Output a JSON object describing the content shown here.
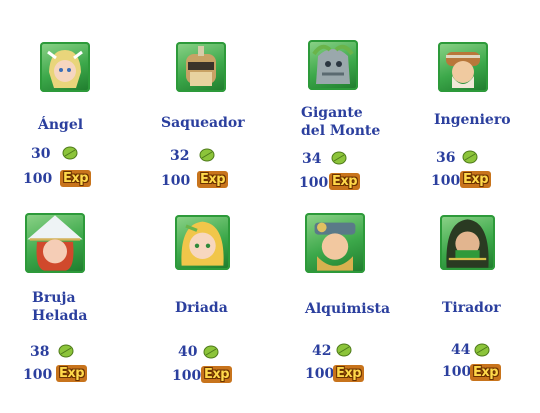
{
  "heroes": [
    {
      "name": "Ángel",
      "level": "30",
      "exp": "100",
      "exp_badge": "Exp",
      "icon": "angel-portrait",
      "hair": "#e9d57b",
      "skin": "#f6d6c0"
    },
    {
      "name": "Saqueador",
      "level": "32",
      "exp": "100",
      "exp_badge": "Exp",
      "icon": "looter-portrait",
      "hair": "#6b5a3a",
      "skin": "#c8a265"
    },
    {
      "name": "Gigante del Monte",
      "name_lines": [
        "Gigante",
        "del Monte"
      ],
      "level": "34",
      "exp": "100",
      "exp_badge": "Exp",
      "icon": "mountain-giant-portrait",
      "hair": "#7f8a8e",
      "skin": "#9aa8ac"
    },
    {
      "name": "Ingeniero",
      "level": "36",
      "exp": "100",
      "exp_badge": "Exp",
      "icon": "engineer-portrait",
      "hair": "#b8773a",
      "skin": "#f0caa0"
    },
    {
      "name": "Bruja Helada",
      "name_lines": [
        "Bruja",
        "Helada"
      ],
      "level": "38",
      "exp": "100",
      "exp_badge": "Exp",
      "icon": "ice-witch-portrait",
      "hair": "#d0492c",
      "skin": "#f5cdb6"
    },
    {
      "name": "Driada",
      "level": "40",
      "exp": "100",
      "exp_badge": "Exp",
      "icon": "dryad-portrait",
      "hair": "#f1c64a",
      "skin": "#f7d7bf"
    },
    {
      "name": "Alquimista",
      "level": "42",
      "exp": "100",
      "exp_badge": "Exp",
      "icon": "alchemist-portrait",
      "hair": "#d8b14f",
      "skin": "#f2c8a0"
    },
    {
      "name": "Tirador",
      "level": "44",
      "exp": "100",
      "exp_badge": "Exp",
      "icon": "marksman-portrait",
      "hair": "#2a3a22",
      "skin": "#e2b58f"
    }
  ],
  "colors": {
    "text": "#2b3f9e",
    "portrait_bg": "#3ca84a",
    "leaf": "#8cc43a",
    "exp_badge": "#c8741c"
  }
}
